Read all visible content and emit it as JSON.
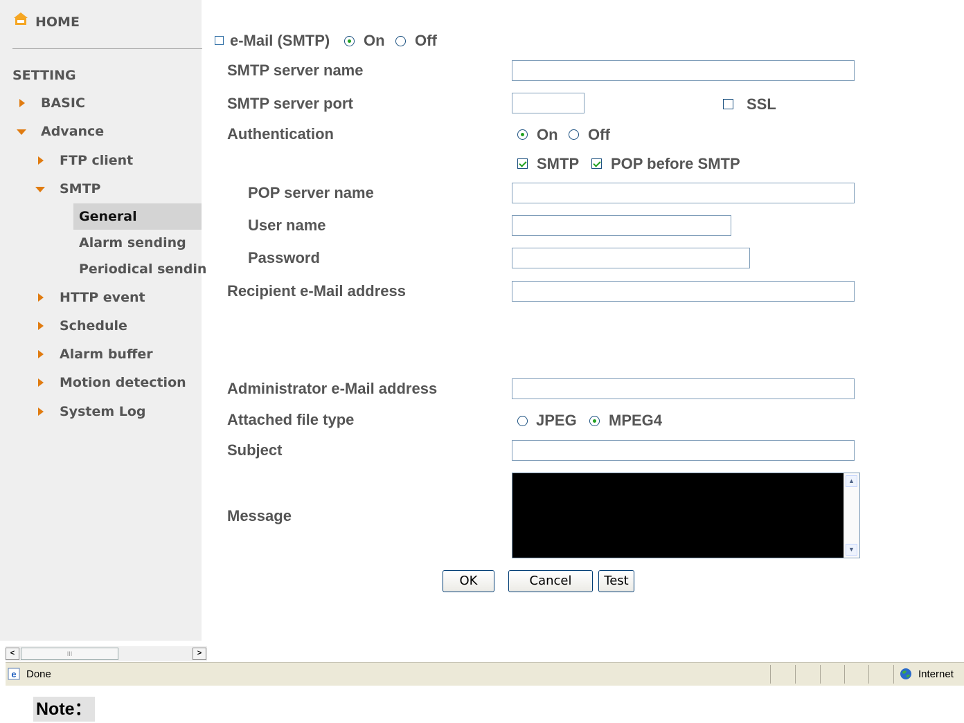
{
  "sidebar": {
    "home": "HOME",
    "setting": "SETTING",
    "items": {
      "basic": "BASIC",
      "advance": "Advance",
      "ftp_client": "FTP client",
      "smtp": "SMTP",
      "general": "General",
      "alarm_sending": "Alarm sending",
      "periodical_sending": "Periodical sendin",
      "http_event": "HTTP event",
      "schedule": "Schedule",
      "alarm_buffer": "Alarm buffer",
      "motion_detection": "Motion detection",
      "system_log": "System Log"
    }
  },
  "form": {
    "email_title": "e-Mail (SMTP)",
    "email_on": "On",
    "email_off": "Off",
    "smtp_server_name": "SMTP server name",
    "smtp_server_port": "SMTP server port",
    "ssl": "SSL",
    "authentication": "Authentication",
    "auth_on": "On",
    "auth_off": "Off",
    "auth_smtp": "SMTP",
    "auth_pop_before_smtp": "POP before SMTP",
    "pop_server_name": "POP server name",
    "user_name": "User name",
    "password": "Password",
    "recipient_email": "Recipient e-Mail address",
    "admin_email": "Administrator e-Mail address",
    "attached_file_type": "Attached file type",
    "jpeg": "JPEG",
    "mpeg4": "MPEG4",
    "subject": "Subject",
    "message": "Message",
    "ok": "OK",
    "cancel": "Cancel",
    "test": "Test"
  },
  "state": {
    "email_enabled": "On",
    "authentication": "On",
    "ssl_checked": false,
    "smtp_checked": true,
    "pop_before_smtp_checked": true,
    "attached_file_type": "MPEG4"
  },
  "scrollbar": {
    "left": "<",
    "right": ">",
    "grip": "III"
  },
  "statusbar": {
    "status": "Done",
    "zone": "Internet"
  },
  "note": "Note："
}
